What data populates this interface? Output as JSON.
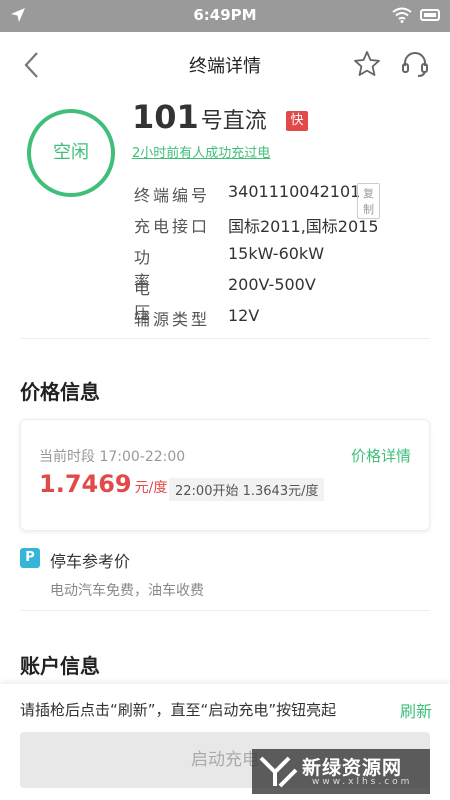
{
  "status_bar": {
    "time": "6:49PM",
    "icons": [
      "location-arrow-icon",
      "wifi-icon",
      "battery-icon"
    ]
  },
  "nav": {
    "title": "终端详情",
    "icons": [
      "back-chevron-icon",
      "star-icon",
      "headset-icon"
    ]
  },
  "terminal": {
    "status": "空闲",
    "number": "101",
    "name_suffix": "号直流",
    "fast_badge": "快",
    "last_charge": "2小时前有人成功充过电",
    "specs": [
      {
        "label": "终端编号",
        "value": "3401110042101"
      },
      {
        "label": "充电接口",
        "value": "国标2011,国标2015"
      },
      {
        "label": "功率",
        "value": "15kW-60kW"
      },
      {
        "label": "电压",
        "value": "200V-500V"
      },
      {
        "label": "辅源类型",
        "value": "12V"
      }
    ],
    "copy_label": "复制"
  },
  "price_section": {
    "title": "价格信息",
    "period": "当前时段 17:00-22:00",
    "detail_link": "价格详情",
    "price": "1.7469",
    "unit": "元/度",
    "next": "22:00开始  1.3643元/度"
  },
  "parking": {
    "icon_label": "P",
    "title": "停车参考价",
    "desc": "电动汽车免费，油车收费"
  },
  "account_section": {
    "title": "账户信息"
  },
  "bottom": {
    "hint": "请插枪后点击“刷新”，直至“启动充电”按钮亮起",
    "refresh": "刷新",
    "start_button": "启动充电"
  },
  "watermark": {
    "text": "新绿资源网",
    "url": "www.xlhs.com"
  },
  "colors": {
    "accent_green": "#3fbf7a",
    "price_red": "#e24a4a",
    "parking_blue": "#35b6d9",
    "status_bar_gray": "#9a9a9a"
  }
}
